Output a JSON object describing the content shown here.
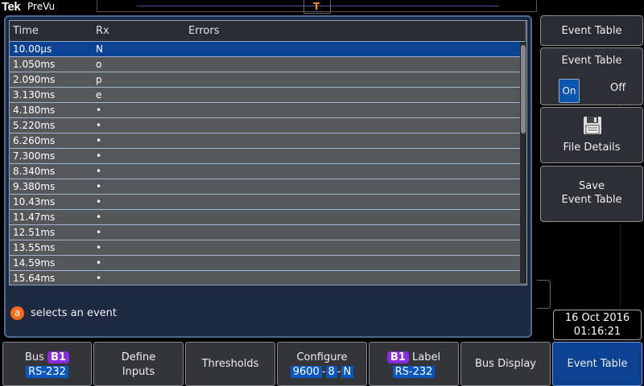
{
  "header": {
    "logo": "Tek",
    "mode": "PreVu",
    "trigger_marker": "T"
  },
  "colors": {
    "panel_bg": "#1e2a42",
    "selected_row": "#0b4392",
    "accent_orange": "#ff6a1a",
    "bus_badge": "#8a2be2",
    "active_button": "#0b4392"
  },
  "event_table": {
    "columns": [
      "Time",
      "Rx",
      "Errors"
    ],
    "selected_index": 0,
    "rows": [
      {
        "time": "10.00µs",
        "rx": "N",
        "errors": ""
      },
      {
        "time": "1.050ms",
        "rx": "o",
        "errors": ""
      },
      {
        "time": "2.090ms",
        "rx": "p",
        "errors": ""
      },
      {
        "time": "3.130ms",
        "rx": "e",
        "errors": ""
      },
      {
        "time": "4.180ms",
        "rx": "•",
        "errors": ""
      },
      {
        "time": "5.220ms",
        "rx": "•",
        "errors": ""
      },
      {
        "time": "6.260ms",
        "rx": "•",
        "errors": ""
      },
      {
        "time": "7.300ms",
        "rx": "•",
        "errors": ""
      },
      {
        "time": "8.340ms",
        "rx": "•",
        "errors": ""
      },
      {
        "time": "9.380ms",
        "rx": "•",
        "errors": ""
      },
      {
        "time": "10.43ms",
        "rx": "•",
        "errors": ""
      },
      {
        "time": "11.47ms",
        "rx": "•",
        "errors": ""
      },
      {
        "time": "12.51ms",
        "rx": "•",
        "errors": ""
      },
      {
        "time": "13.55ms",
        "rx": "•",
        "errors": ""
      },
      {
        "time": "14.59ms",
        "rx": "•",
        "errors": ""
      },
      {
        "time": "15.64ms",
        "rx": "•",
        "errors": ""
      }
    ]
  },
  "hint": {
    "knob": "a",
    "text": "selects an event"
  },
  "side_menu": {
    "title": "Event Table",
    "toggle_label": "Event Table",
    "on_label": "On",
    "off_label": "Off",
    "file_details_icon": "floppy-disk-icon",
    "file_details_label": "File Details",
    "save_line1": "Save",
    "save_line2": "Event Table"
  },
  "datetime": {
    "date": "16 Oct  2016",
    "time": "01:16:21"
  },
  "bottom_menu": {
    "bus": {
      "label": "Bus",
      "badge": "B1",
      "value": "RS-232"
    },
    "define_inputs": {
      "line1": "Define",
      "line2": "Inputs"
    },
    "thresholds": {
      "label": "Thresholds"
    },
    "configure": {
      "label": "Configure",
      "baud": "9600",
      "bits": "8",
      "parity": "N",
      "sep": "-"
    },
    "label": {
      "badge": "B1",
      "label": "Label",
      "value": "RS-232"
    },
    "bus_display": {
      "label": "Bus Display"
    },
    "event_table": {
      "label": "Event Table"
    }
  }
}
